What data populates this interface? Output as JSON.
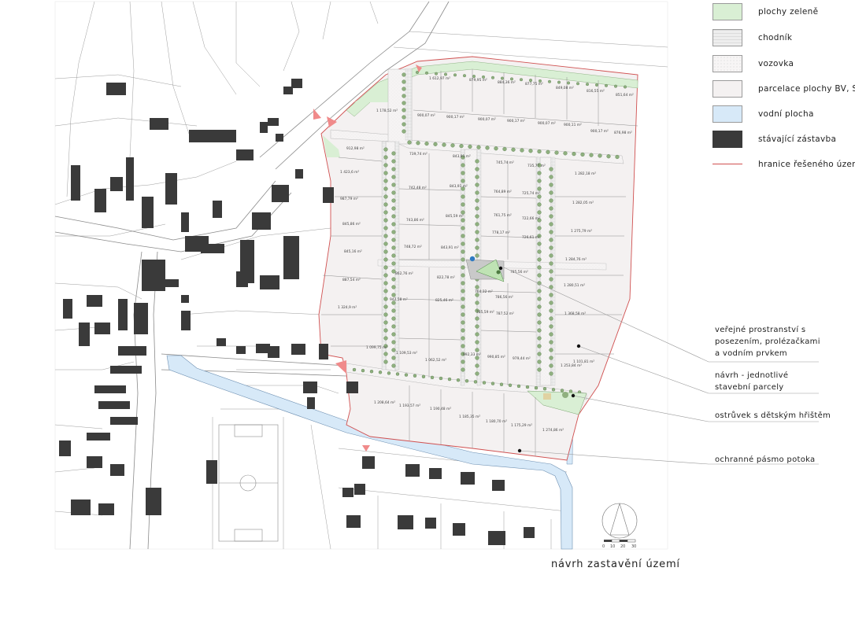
{
  "legend": [
    {
      "id": "green",
      "label": "plochy zeleně",
      "color": "#d9efd4"
    },
    {
      "id": "sidewalk",
      "label": "chodník",
      "color": "#f0f0f0"
    },
    {
      "id": "road",
      "label": "vozovka",
      "color": "#f7f5f5"
    },
    {
      "id": "plots",
      "label": "parcelace plochy BV, SV",
      "color": "#f4f1f1"
    },
    {
      "id": "water",
      "label": "vodní plocha",
      "color": "#d7e9f8"
    },
    {
      "id": "buildings",
      "label": "stávající zástavba",
      "color": "#3a3a3a"
    },
    {
      "id": "boundary",
      "label": "hranice řešeného území",
      "color": "#d05050"
    }
  ],
  "annotations": [
    {
      "id": "public-space",
      "text": "veřejné prostranství s\nposezením, prolézačkami\na vodním prvkem"
    },
    {
      "id": "plots",
      "text": "návrh - jednotlivé\nstavební parcely"
    },
    {
      "id": "playground",
      "text": "ostrůvek s dětským hřištěm"
    },
    {
      "id": "buffer",
      "text": "ochranné pásmo potoka"
    }
  ],
  "title": "návrh zastavění území",
  "scale_labels": [
    "0",
    "10",
    "20",
    "30"
  ],
  "parcel_areas": [
    "1 612,97 m²",
    "879,95 m²",
    "884,36 m²",
    "877,75 m²",
    "849,08 m²",
    "816,55 m²",
    "851,64 m²",
    "1 178,52 m²",
    "900,07 m²",
    "900,17 m²",
    "900,07 m²",
    "900,17 m²",
    "900,07 m²",
    "900,11 m²",
    "900,17 m²",
    "876,98 m²",
    "912,98 m²",
    "739,74 m²",
    "843,91 m²",
    "745,74 m²",
    "735,77 m²",
    "1 282,18 m²",
    "1 423,6 m²",
    "742,48 m²",
    "843,91 m²",
    "764,89 m²",
    "725,74 m²",
    "1 282,05 m²",
    "987,79 m²",
    "743,86 m²",
    "845,59 m²",
    "761,75 m²",
    "722,66 m²",
    "845,86 m²",
    "748,72 m²",
    "843,91 m²",
    "778,17 m²",
    "726,61 m²",
    "1 275,79 m²",
    "845,16 m²",
    "862,76 m²",
    "822,78 m²",
    "785,56 m²",
    "1 284,76 m²",
    "887,54 m²",
    "942,58 m²",
    "825,46 m²",
    "764,32 m²",
    "786,56 m²",
    "1 280,51 m²",
    "1 324,9 m²",
    "785,59 m²",
    "787,52 m²",
    "1 368,58 m²",
    "1 099,75 m²",
    "1 109,53 m²",
    "1 062,52 m²",
    "992,33 m²",
    "990,85 m²",
    "979,44 m²",
    "1 253,84 m²",
    "1 101,81 m²",
    "1 208,64 m²",
    "1 193,57 m²",
    "1 190,48 m²",
    "1 185,35 m²",
    "1 180,70 m²",
    "1 175,29 m²",
    "1 274,86 m²"
  ]
}
